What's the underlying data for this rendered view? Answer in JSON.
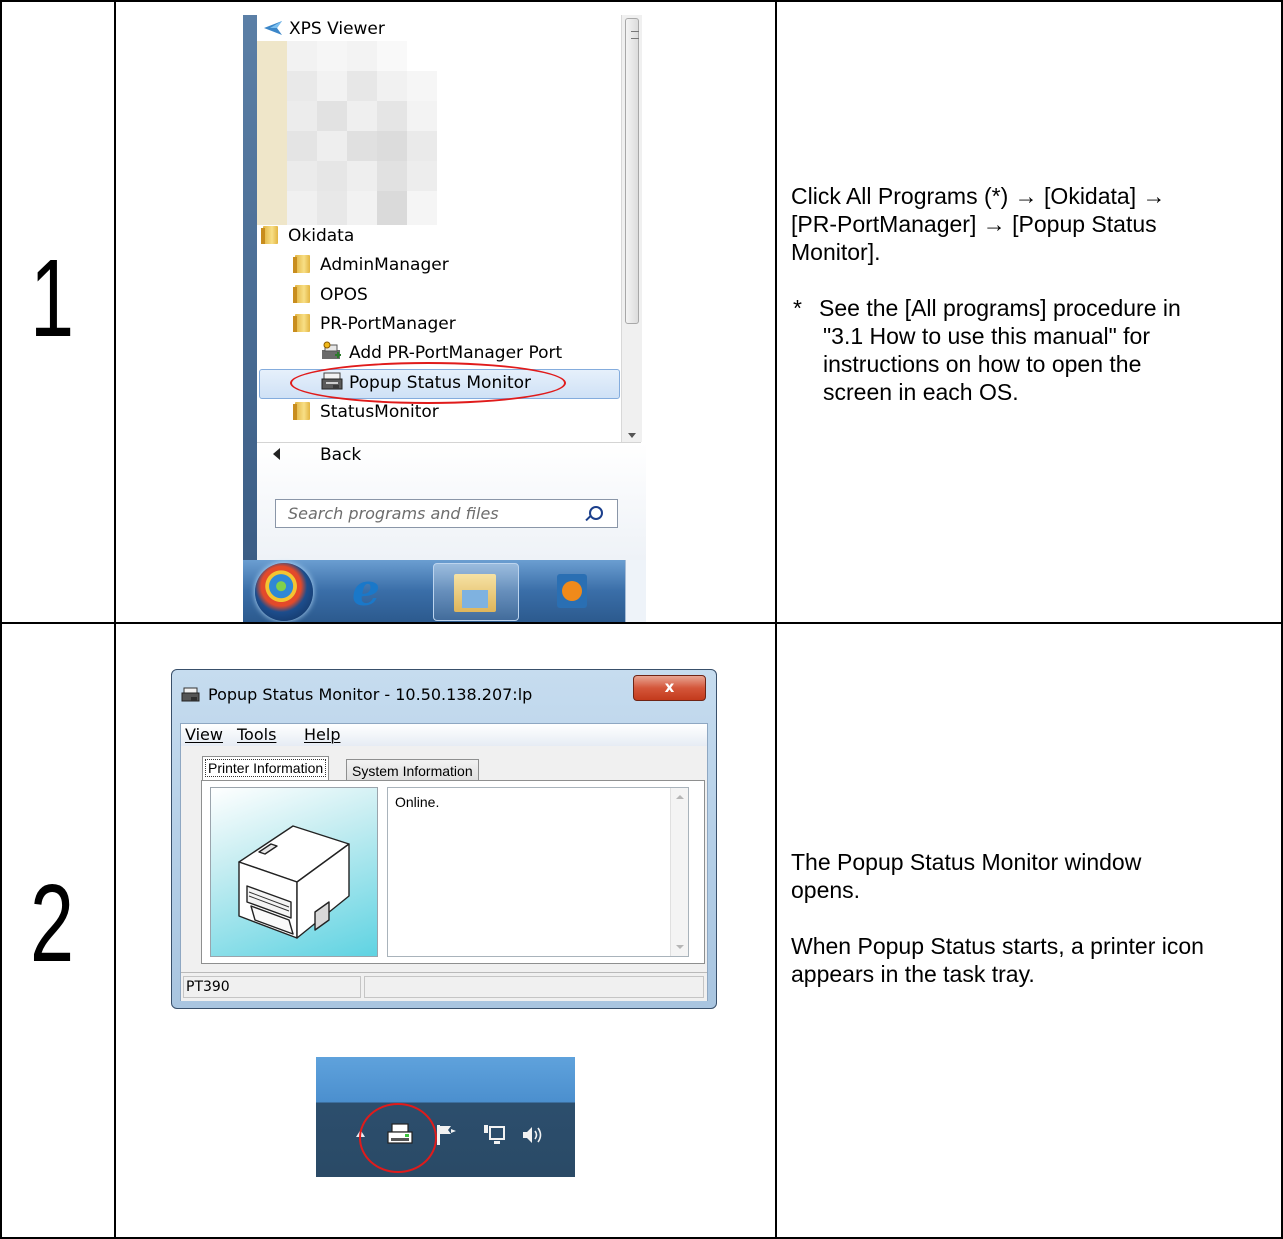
{
  "steps": [
    {
      "number": "1",
      "description": {
        "line1": "Click All Programs (*) → [Okidata] →",
        "line2": "[PR-PortManager] → [Popup Status",
        "line3": "Monitor].",
        "note_mark": "*",
        "note_line1": "See the [All programs] procedure in",
        "note_line2": "\"3.1 How to use this manual\" for",
        "note_line3": "instructions on how to open the",
        "note_line4": "screen in each OS."
      },
      "start_menu": {
        "items": {
          "xps_viewer": "XPS Viewer",
          "okidata": "Okidata",
          "admin_manager": "AdminManager",
          "opos": "OPOS",
          "pr_portmanager": "PR-PortManager",
          "add_port": "Add PR-PortManager Port",
          "popup_status_monitor": "Popup Status Monitor",
          "status_monitor": "StatusMonitor"
        },
        "back_label": "Back",
        "search_placeholder": "Search programs and files",
        "highlight_color": "#e01b1b"
      }
    },
    {
      "number": "2",
      "description": {
        "para1_line1": "The Popup Status Monitor window",
        "para1_line2": "opens.",
        "para2_line1": "When Popup Status starts, a printer icon",
        "para2_line2": "appears in the task tray."
      },
      "window": {
        "title": "Popup Status Monitor - 10.50.138.207:lp",
        "close_label": "x",
        "menu": {
          "view": "View",
          "tools": "Tools",
          "help": "Help"
        },
        "tabs": {
          "active": "Printer Information",
          "inactive": "System Information"
        },
        "status_text": "Online.",
        "model": "PT390"
      }
    }
  ]
}
